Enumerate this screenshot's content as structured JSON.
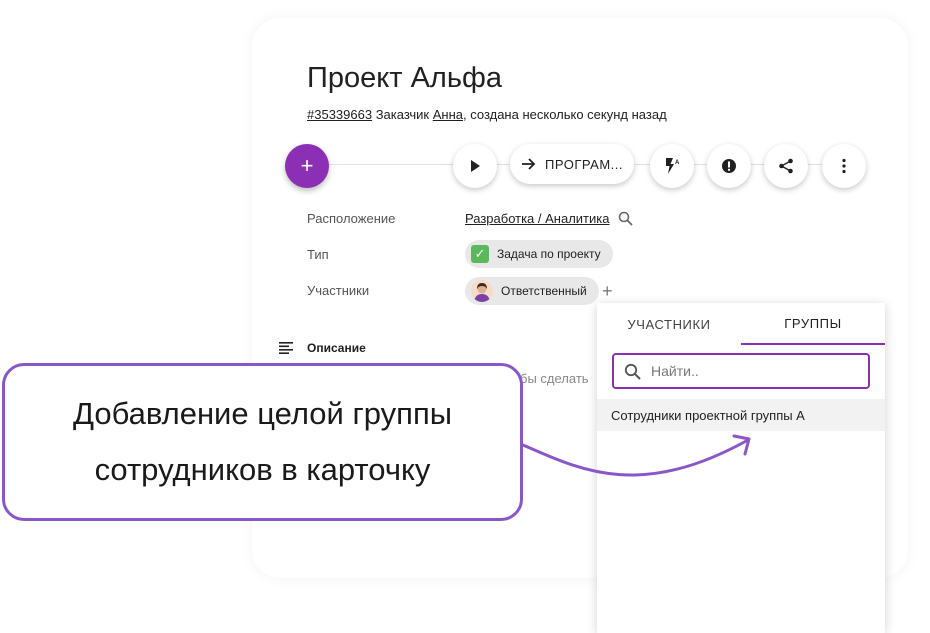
{
  "card": {
    "title": "Проект Альфа",
    "meta": {
      "id": "#35339663",
      "customer_label": "Заказчик",
      "customer_name": "Анна",
      "created": ", создана несколько секунд назад"
    }
  },
  "toolbar": {
    "add_icon": "plus-icon",
    "play_icon": "play-icon",
    "program_button": "ПРОГРАМ...",
    "program_icon": "arrow-right-icon",
    "flash_icon": "flash-auto-icon",
    "alert_icon": "alert-circle-icon",
    "share_icon": "share-icon",
    "more_icon": "more-vertical-icon",
    "accent_color": "#8b2fb5"
  },
  "fields": {
    "location_label": "Расположение",
    "location_value": "Разработка / Аналитика",
    "type_label": "Тип",
    "type_value": "Задача по проекту",
    "members_label": "Участники",
    "members_chip": "Ответственный",
    "add_member": "+"
  },
  "description": {
    "label": "Описание",
    "placeholder_tail": "бы сделать"
  },
  "dropdown": {
    "tabs": [
      "УЧАСТНИКИ",
      "ГРУППЫ"
    ],
    "active_tab": "ГРУППЫ",
    "search_placeholder": "Найти..",
    "items": [
      "Сотрудники проектной группы А"
    ]
  },
  "callout": {
    "line1": "Добавление целой группы",
    "line2": "сотрудников в карточку",
    "border_color": "#8a57c8"
  }
}
